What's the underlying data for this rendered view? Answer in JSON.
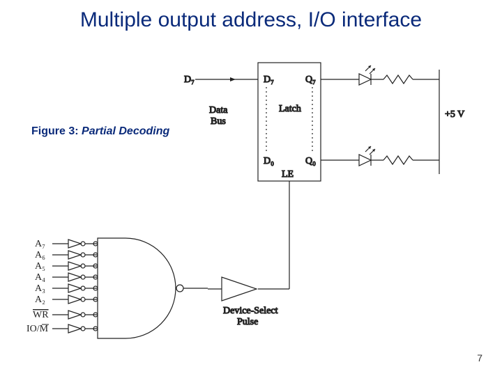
{
  "title": "Multiple output address, I/O interface",
  "figure_label_prefix": "Figure 3: ",
  "figure_label_italic": "Partial Decoding",
  "page_number": "7",
  "latch_block": "Latch",
  "data_bus_label_1": "Data",
  "data_bus_label_2": "Bus",
  "device_select_1": "Device-Select",
  "device_select_2": "Pulse",
  "voltage": "+5 V",
  "pins": {
    "d7_in": "D₇",
    "d7_pin": "D₇",
    "q7_pin": "Q₇",
    "d0_pin": "D₀",
    "q0_pin": "Q₀",
    "le_pin": "LE"
  },
  "addr": {
    "a7": "A₇",
    "a6": "A₆",
    "a5": "A₅",
    "a4": "A₄",
    "a3": "A₃",
    "a2": "A₂",
    "wr": "WR",
    "iom": "IO/M"
  }
}
